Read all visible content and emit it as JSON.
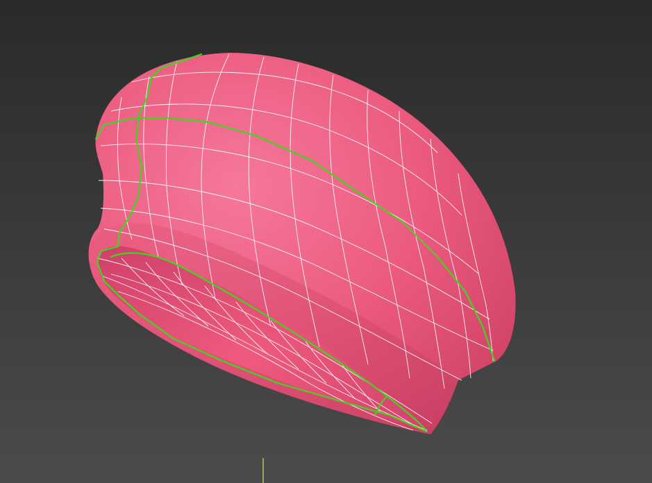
{
  "viewport": {
    "model": "beret-mesh",
    "colors": {
      "background_top": "#2b2b2b",
      "background_bottom": "#4a4a4a",
      "surface_light": "#f06a8c",
      "surface_mid": "#e85478",
      "surface_dark": "#c23a5c",
      "interior": "#e04c70",
      "wire": "#ffffff",
      "seam": "#3fd61f",
      "axis": "#d8e05a"
    }
  }
}
